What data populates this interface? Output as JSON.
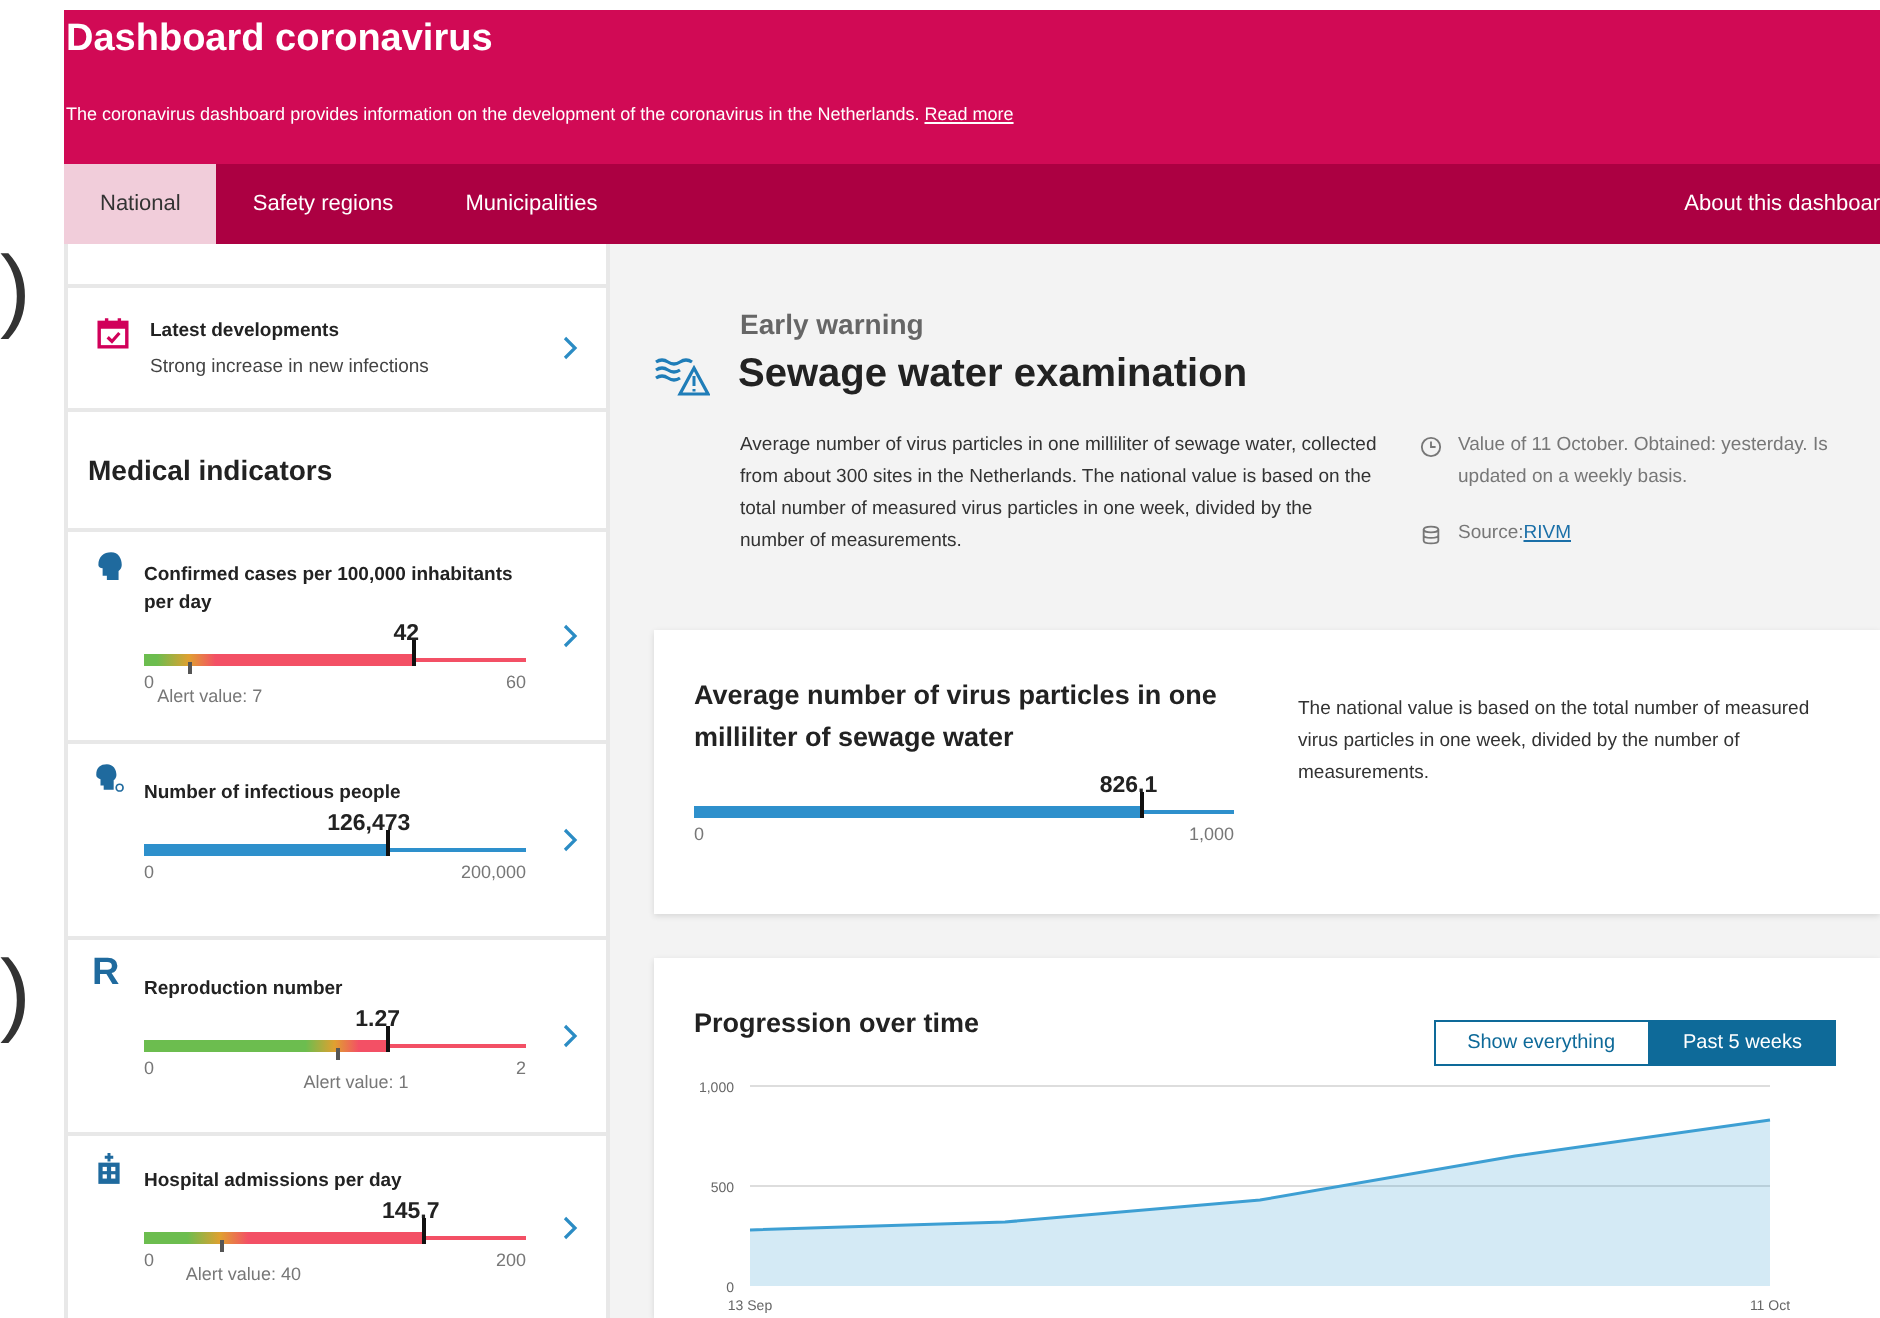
{
  "edge_glyphs": [
    ")",
    ")"
  ],
  "header": {
    "title": "Dashboard coronavirus",
    "description": "The coronavirus dashboard provides information on the development of the coronavirus in the Netherlands.",
    "link": "Read more"
  },
  "tabs": [
    {
      "label": "National",
      "selected": true
    },
    {
      "label": "Safety regions",
      "selected": false
    },
    {
      "label": "Municipalities",
      "selected": false
    }
  ],
  "about_link": "About this dashboar",
  "sidebar": {
    "latest": {
      "title": "Latest developments",
      "subtitle": "Strong increase in new infections"
    },
    "section_title": "Medical indicators",
    "indicators": [
      {
        "kind": "risk",
        "title": "Confirmed cases per 100,000 inhabitants per day",
        "value": "42",
        "level": 0.7,
        "min": "0",
        "max": "60",
        "alert": {
          "label": "Alert value: 7",
          "level": 0.117
        }
      },
      {
        "kind": "plain",
        "title": "Number of infectious people",
        "value": "126,473",
        "level": 0.632,
        "min": "0",
        "max": "200,000"
      },
      {
        "kind": "risk",
        "icon_text": "R",
        "title": "Reproduction number",
        "value": "1.27",
        "level": 0.635,
        "min": "0",
        "max": "2",
        "alert": {
          "label": "Alert value: 1",
          "level": 0.5
        }
      },
      {
        "kind": "risk",
        "title": "Hospital admissions per day",
        "value": "145.7",
        "level": 0.7285,
        "min": "0",
        "max": "200",
        "alert": {
          "label": "Alert value: 40",
          "level": 0.2
        }
      }
    ]
  },
  "main": {
    "eyebrow": "Early warning",
    "title": "Sewage water examination",
    "description": "Average number of virus particles in one milliliter of sewage water, collected from about 300 sites in the Netherlands. The national value is based on the total number of measured virus particles in one week, divided by the number of measurements.",
    "updated": "Value of 11 October. Obtained: yesterday. Is updated on a weekly basis.",
    "source_label": "Source:",
    "source_link": "RIVM",
    "average_card": {
      "title": "Average number of virus particles in one milliliter of sewage water",
      "value": "826.1",
      "level": 0.826,
      "min": "0",
      "max": "1,000",
      "note": "The national value is based on the total number of measured virus particles in one week, divided by the number of measurements."
    },
    "progression": {
      "title": "Progression over time",
      "toggle": [
        {
          "label": "Show everything",
          "selected": false
        },
        {
          "label": "Past 5 weeks",
          "selected": true
        }
      ],
      "chart_data": {
        "type": "area",
        "categories": [
          "13 Sep",
          null,
          null,
          null,
          "11 Oct"
        ],
        "series": [
          {
            "color": "#3d9fd3",
            "values": [
              280,
              320,
              430,
              650,
              830
            ]
          }
        ],
        "ylim": [
          0,
          1000
        ],
        "yticks": [
          0,
          500,
          {
            "value": 1000,
            "label": "1,000"
          }
        ]
      }
    }
  }
}
